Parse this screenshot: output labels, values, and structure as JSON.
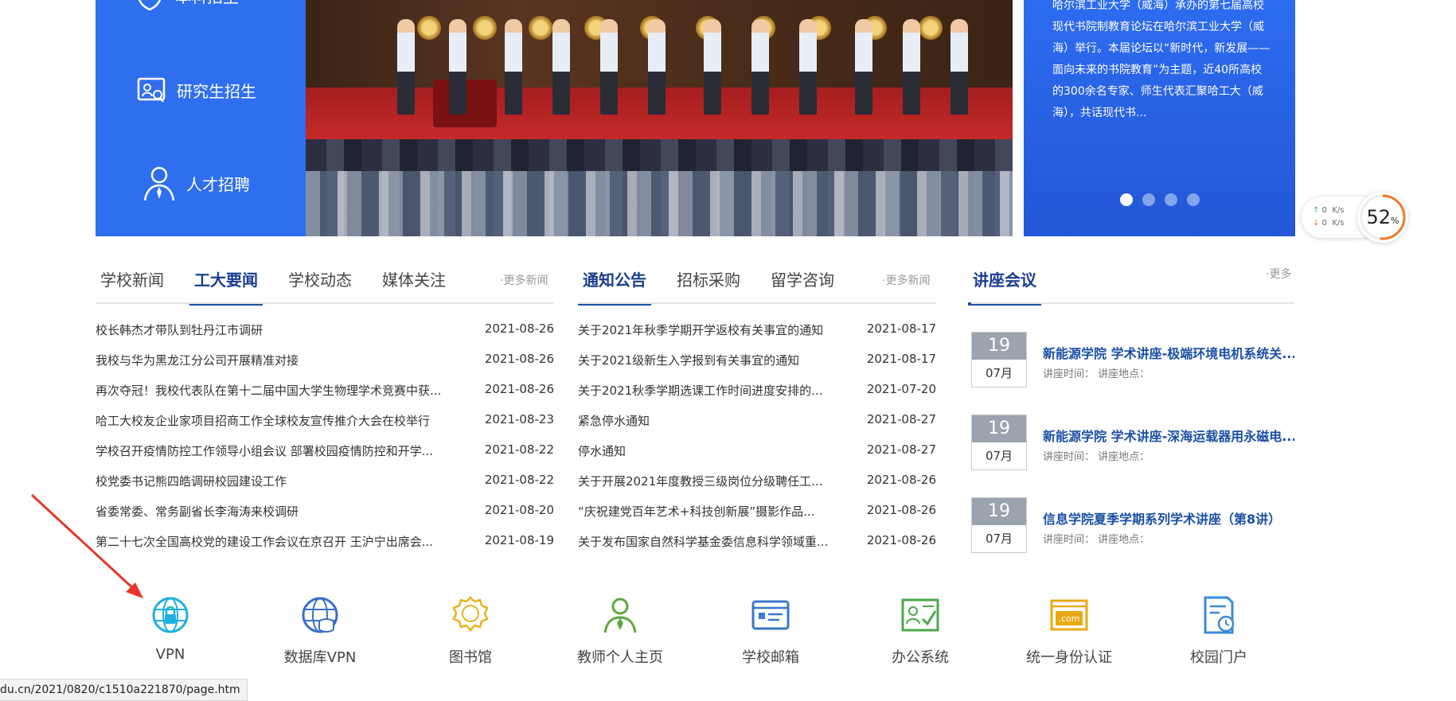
{
  "sidebar": {
    "items": [
      {
        "label": "本科招生",
        "icon": "shield-icon"
      },
      {
        "label": "研究生招生",
        "icon": "id-card-icon"
      },
      {
        "label": "人才招聘",
        "icon": "user-tie-icon"
      }
    ]
  },
  "banner": {
    "summary": "哈尔滨工业大学（威海）承办的第七届高校现代书院制教育论坛在哈尔滨工业大学（威海）举行。本届论坛以“新时代，新发展——面向未来的书院教育”为主题，近40所高校的300余名专家、师生代表汇聚哈工大（威海），共话现代书..."
  },
  "speed_widget": {
    "up": "0",
    "up_unit": "K/s",
    "down": "0",
    "down_unit": "K/s",
    "percent": "52",
    "percent_sign": "%"
  },
  "news": {
    "tabs": [
      "学校新闻",
      "工大要闻",
      "学校动态",
      "媒体关注"
    ],
    "active_tab": 1,
    "more": "·更多新闻",
    "items": [
      {
        "title": "校长韩杰才带队到牡丹江市调研",
        "date": "2021-08-26"
      },
      {
        "title": "我校与华为黑龙江分公司开展精准对接",
        "date": "2021-08-26"
      },
      {
        "title": "再次夺冠！我校代表队在第十二届中国大学生物理学术竞赛中获...",
        "date": "2021-08-26"
      },
      {
        "title": "哈工大校友企业家项目招商工作全球校友宣传推介大会在校举行",
        "date": "2021-08-23"
      },
      {
        "title": "学校召开疫情防控工作领导小组会议 部署校园疫情防控和开学...",
        "date": "2021-08-22"
      },
      {
        "title": "校党委书记熊四皓调研校园建设工作",
        "date": "2021-08-22"
      },
      {
        "title": "省委常委、常务副省长李海涛来校调研",
        "date": "2021-08-20"
      },
      {
        "title": "第二十七次全国高校党的建设工作会议在京召开 王沪宁出席会...",
        "date": "2021-08-19"
      }
    ]
  },
  "notices": {
    "tabs": [
      "通知公告",
      "招标采购",
      "留学咨询"
    ],
    "active_tab": 0,
    "more": "·更多新闻",
    "items": [
      {
        "title": "关于2021年秋季学期开学返校有关事宜的通知",
        "date": "2021-08-17"
      },
      {
        "title": "关于2021级新生入学报到有关事宜的通知",
        "date": "2021-08-17"
      },
      {
        "title": "关于2021秋季学期选课工作时间进度安排的...",
        "date": "2021-07-20"
      },
      {
        "title": "紧急停水通知",
        "date": "2021-08-27"
      },
      {
        "title": "停水通知",
        "date": "2021-08-27"
      },
      {
        "title": "关于开展2021年度教授三级岗位分级聘任工...",
        "date": "2021-08-26"
      },
      {
        "title": "“庆祝建党百年艺术+科技创新展”摄影作品...",
        "date": "2021-08-26"
      },
      {
        "title": "关于发布国家自然科学基金委信息科学领域重...",
        "date": "2021-08-26"
      }
    ]
  },
  "lectures": {
    "title": "讲座会议",
    "more": "·更多",
    "items": [
      {
        "day": "19",
        "month": "07月",
        "title": "新能源学院 学术讲座-极端环境电机系统关...",
        "meta": "讲座时间：  讲座地点："
      },
      {
        "day": "19",
        "month": "07月",
        "title": "新能源学院 学术讲座-深海运载器用永磁电...",
        "meta": "讲座时间：  讲座地点："
      },
      {
        "day": "19",
        "month": "07月",
        "title": "信息学院夏季学期系列学术讲座（第8讲）",
        "meta": "讲座时间：  讲座地点："
      }
    ]
  },
  "quick_links": [
    {
      "label": "VPN",
      "icon": "globe-lock-icon",
      "color": "#1fb0e0"
    },
    {
      "label": "数据库VPN",
      "icon": "globe-database-icon",
      "color": "#3a6fc8"
    },
    {
      "label": "图书馆",
      "icon": "badge-icon",
      "color": "#e8b21a"
    },
    {
      "label": "教师个人主页",
      "icon": "teacher-icon",
      "color": "#5aa83a"
    },
    {
      "label": "学校邮箱",
      "icon": "mail-card-icon",
      "color": "#3a78c8"
    },
    {
      "label": "办公系统",
      "icon": "office-cert-icon",
      "color": "#4aa84a"
    },
    {
      "label": "统一身份认证",
      "icon": "dotcom-icon",
      "color": "#e8a915"
    },
    {
      "label": "校园门户",
      "icon": "calendar-clock-icon",
      "color": "#3a8ad8"
    }
  ],
  "status_bar": {
    "url": "du.cn/2021/0820/c1510a221870/page.htm"
  },
  "colors": {
    "primary_blue": "#2f6fef",
    "heading_blue": "#1a3d8f",
    "accent_orange": "#f07a28",
    "arrow_red": "#e8362b"
  }
}
